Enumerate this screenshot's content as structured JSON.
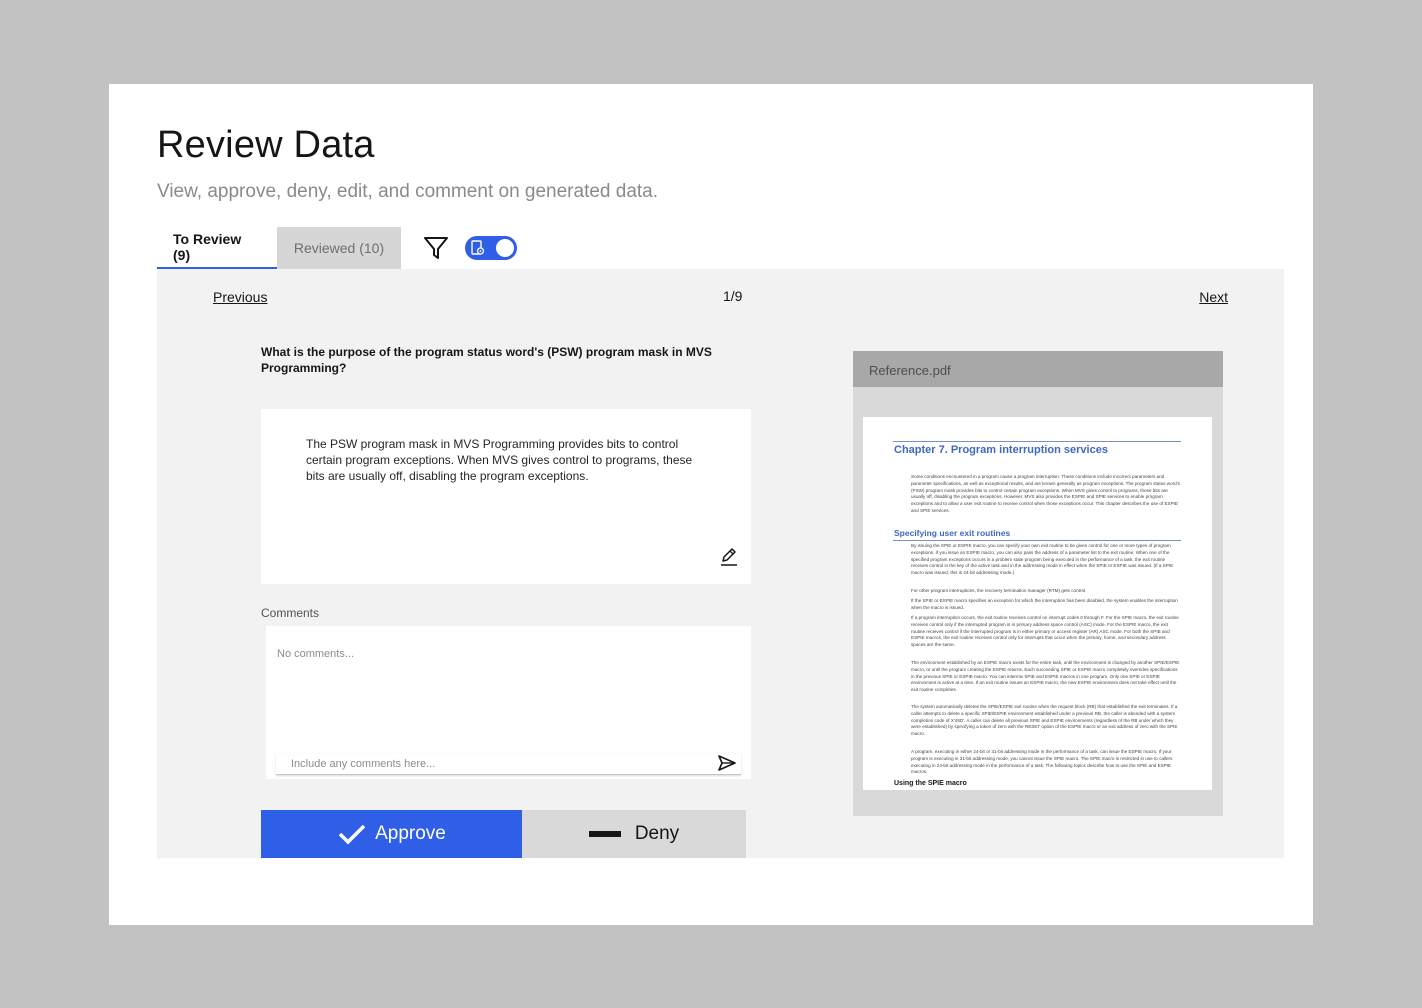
{
  "header": {
    "title": "Review Data",
    "subtitle": "View, approve, deny, edit, and comment on generated data."
  },
  "tabs": [
    {
      "label": "To Review (9)",
      "active": true
    },
    {
      "label": "Reviewed (10)",
      "active": false
    }
  ],
  "toolbar": {
    "filter_icon": "filter-icon",
    "toggle_on": true,
    "accent_color": "#2f5fe6"
  },
  "navigation": {
    "previous": "Previous",
    "next": "Next",
    "pager": "1/9"
  },
  "item": {
    "question": "What is the purpose of the program status word's (PSW) program mask in MVS Programming?",
    "answer": "The PSW program mask in MVS Programming provides bits to control certain program exceptions. When MVS gives control to programs, these bits are usually off, disabling the program exceptions."
  },
  "comments": {
    "label": "Comments",
    "empty_text": "No comments...",
    "input_placeholder": "Include any comments here..."
  },
  "actions": {
    "approve": "Approve",
    "deny": "Deny"
  },
  "reference": {
    "filename": "Reference.pdf",
    "chapter": "Chapter 7. Program interruption services",
    "section": "Specifying user exit routines",
    "bottom_heading": "Using the SPIE macro",
    "paragraphs": [
      "Some conditions encountered in a program cause a program interruption. These conditions include incorrect parameters and parameter specifications, as well as exceptional results, and are known generally as program exceptions. The program status word's (PSW) program mask provides bits to control certain program exceptions. When MVS gives control to programs, these bits are usually off, disabling the program exceptions. However, MVS also provides the ESPIE and SPIE services to enable program exceptions and to allow a user exit routine to receive control when those exceptions occur. This chapter describes the use of ESPIE and SPIE services.",
      "By issuing the SPIE or ESPIE macro, you can specify your own exit routine to be given control for one or more types of program exceptions. If you issue an ESPIE macro, you can also pass the address of a parameter list to the exit routine. When one of the specified program exceptions occurs in a problem state program being executed in the performance of a task, the exit routine receives control in the key of the active task and in the addressing mode in effect when the SPIE or ESPIE was issued. (If a SPIE macro was issued, this is 24-bit addressing mode.)",
      "For other program interruptions, the recovery termination manager (RTM) gets control.",
      "If the SPIE or ESPIE macro specifies an exception for which the interruption has been disabled, the system enables the interruption when the macro is issued.",
      "If a program interruption occurs, the exit routine receives control on interrupt codes 0 through F. For the SPIE macro, the exit routine receives control only if the interrupted program is in primary address space control (ASC) mode. For the ESPIE macro, the exit routine receives control if the interrupted program is in either primary or access register (AR) ASC mode. For both the SPIE and ESPIE macros, the exit routine receives control only for interrupts that occur when the primary, home, and secondary address spaces are the same.",
      "The environment established by an ESPIE macro exists for the entire task, until the environment is changed by another SPIE/ESPIE macro, or until the program creating the ESPIE returns. Each succeeding SPIE or ESPIE macro completely overrides specifications in the previous SPIE or ESPIE macro. You can intermix SPIE and ESPIE macros in one program. Only one SPIE or ESPIE environment is active at a time. If an exit routine issues an ESPIE macro, the new ESPIE environment does not take effect until the exit routine completes.",
      "The system automatically deletes the SPIE/ESPIE exit routine when the request block (RB) that established the exit terminates. If a caller attempts to delete a specific SPIE/ESPIE environment established under a previous RB, the caller is abended with a system completion code of X'46D'. A caller can delete all previous SPIE and ESPIE environments (regardless of the RB under which they were established) by specifying a token of zero with the RESET option of the ESPIE macro or an exit address of zero with the SPIE macro.",
      "A program, executing in either 24-bit or 31-bit addressing mode in the performance of a task, can issue the ESPIE macro. If your program is executing in 31-bit addressing mode, you cannot issue the SPIE macro. The SPIE macro is restricted in use to callers executing in 24-bit addressing mode in the performance of a task. The following topics describe how to use the SPIE and ESPIE macros."
    ]
  }
}
